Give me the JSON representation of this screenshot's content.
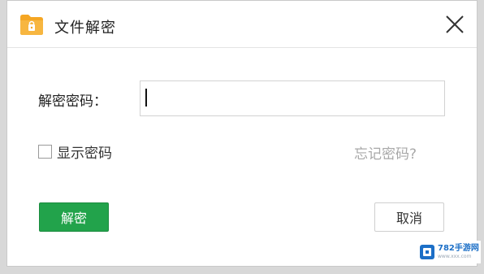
{
  "window": {
    "title": "文件解密",
    "icon": "folder-lock-icon",
    "close_icon": "close-icon"
  },
  "form": {
    "password_label": "解密密码：",
    "password_value": "",
    "show_password_label": "显示密码",
    "show_password_checked": false,
    "forgot_password": "忘记密码?"
  },
  "buttons": {
    "decrypt": "解密",
    "cancel": "取消"
  },
  "watermark": {
    "title": "782手游网",
    "subtitle": "www.xxx.com"
  },
  "colors": {
    "primary_button": "#22a34b",
    "icon_folder": "#f5a623",
    "link_muted": "#a8a8a8"
  }
}
